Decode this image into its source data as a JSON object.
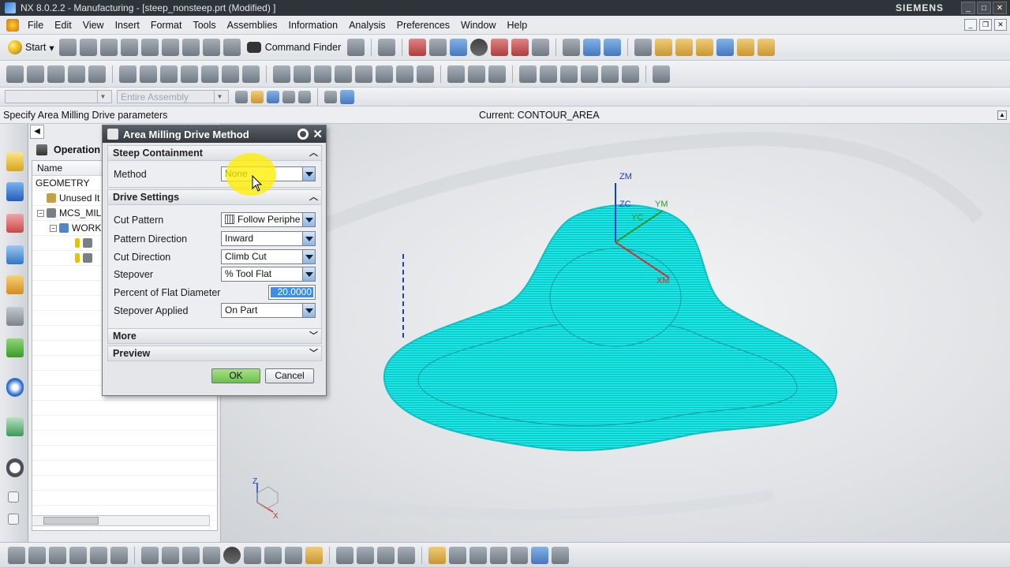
{
  "window": {
    "title": "NX 8.0.2.2 - Manufacturing - [steep_nonsteep.prt (Modified) ]",
    "brand": "SIEMENS"
  },
  "menu": [
    "File",
    "Edit",
    "View",
    "Insert",
    "Format",
    "Tools",
    "Assemblies",
    "Information",
    "Analysis",
    "Preferences",
    "Window",
    "Help"
  ],
  "toolbar": {
    "start_label": "Start",
    "command_finder_label": "Command Finder",
    "assembly_filter": "Entire Assembly"
  },
  "cue_line": {
    "prompt": "Specify Area Milling Drive parameters",
    "status": "Current: CONTOUR_AREA"
  },
  "navigator": {
    "title": "Operation",
    "column_name": "Name",
    "rows": [
      {
        "label": "GEOMETRY"
      },
      {
        "label": "Unused It"
      },
      {
        "label": "MCS_MILL"
      },
      {
        "label": "WORK"
      }
    ]
  },
  "dialog": {
    "title": "Area Milling Drive Method",
    "groups": {
      "steep": {
        "label": "Steep Containment",
        "method_label": "Method",
        "method_value": "None"
      },
      "drive": {
        "label": "Drive Settings",
        "cut_pattern_label": "Cut Pattern",
        "cut_pattern_value": "Follow Periphe",
        "pattern_direction_label": "Pattern Direction",
        "pattern_direction_value": "Inward",
        "cut_direction_label": "Cut Direction",
        "cut_direction_value": "Climb Cut",
        "stepover_label": "Stepover",
        "stepover_value": "% Tool Flat",
        "percent_label": "Percent of Flat Diameter",
        "percent_value": "20.0000",
        "stepover_applied_label": "Stepover Applied",
        "stepover_applied_value": "On Part"
      },
      "more": {
        "label": "More"
      },
      "preview": {
        "label": "Preview"
      }
    },
    "ok_label": "OK",
    "cancel_label": "Cancel"
  },
  "viewport": {
    "triad": {
      "zm": "ZM",
      "zc": "ZC",
      "ym": "YM",
      "yc": "YC",
      "xm": "XM"
    },
    "mini_triad": {
      "z": "Z",
      "x": "X"
    },
    "colors": {
      "toolpath": "#19e8e8",
      "background": "#e2e4e7"
    }
  }
}
